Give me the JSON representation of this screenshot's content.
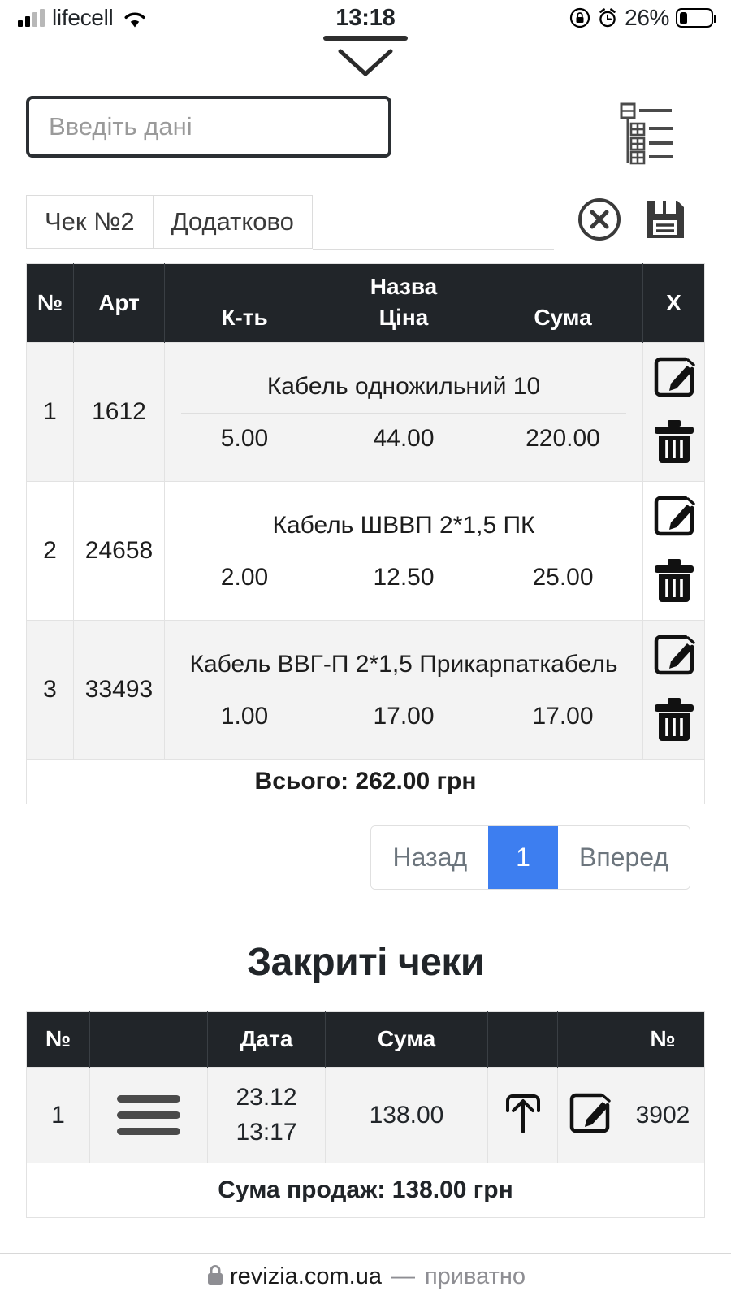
{
  "statusbar": {
    "carrier": "lifecell",
    "time": "13:18",
    "battery_percent": "26%",
    "icons": [
      "signal-bars-icon",
      "wifi-icon",
      "rotation-lock-icon",
      "alarm-icon",
      "battery-icon"
    ]
  },
  "toolbar": {
    "input_placeholder": "Введіть дані",
    "input_value": "",
    "tree_icon": "hierarchy-list-icon",
    "chevron_icon": "chevron-down-icon"
  },
  "tabs": {
    "items": [
      {
        "label": "Чек №2",
        "active": true
      },
      {
        "label": "Додатково",
        "active": false
      }
    ],
    "actions": [
      {
        "name": "close-circle-icon"
      },
      {
        "name": "save-floppy-icon"
      }
    ]
  },
  "receipt_table": {
    "headers": {
      "num": "№",
      "art": "Арт",
      "name": "Назва",
      "qty": "К-ть",
      "price": "Ціна",
      "sum": "Сума",
      "x": "X"
    },
    "rows": [
      {
        "num": "1",
        "art": "1612",
        "name": "Кабель одножильний 10",
        "qty": "5.00",
        "price": "44.00",
        "sum": "220.00"
      },
      {
        "num": "2",
        "art": "24658",
        "name": "Кабель ШВВП 2*1,5 ПК",
        "qty": "2.00",
        "price": "12.50",
        "sum": "25.00"
      },
      {
        "num": "3",
        "art": "33493",
        "name": "Кабель ВВГ-П 2*1,5 Прикарпаткабель",
        "qty": "1.00",
        "price": "17.00",
        "sum": "17.00"
      }
    ],
    "total": "Всього: 262.00 грн",
    "row_actions": [
      "edit-icon",
      "delete-icon"
    ]
  },
  "pagination": {
    "prev": "Назад",
    "current": "1",
    "next": "Вперед",
    "active_color": "#3d7ef0"
  },
  "closed": {
    "title": "Закриті чеки",
    "headers": {
      "num": "№",
      "blank1": "",
      "date": "Дата",
      "sum": "Сума",
      "blank2": "",
      "blank3": "",
      "num2": "№"
    },
    "rows": [
      {
        "num": "1",
        "menu_icon": "hamburger-menu-icon",
        "date": "23.12",
        "time": "13:17",
        "sum": "138.00",
        "upload_icon": "upload-icon",
        "edit_icon": "edit-icon",
        "receipt_no": "3902"
      }
    ],
    "total": "Сума продаж: 138.00 грн"
  },
  "browser_footer": {
    "lock_icon": "lock-icon",
    "url": "revizia.com.ua",
    "dash": "—",
    "mode": "приватно"
  }
}
